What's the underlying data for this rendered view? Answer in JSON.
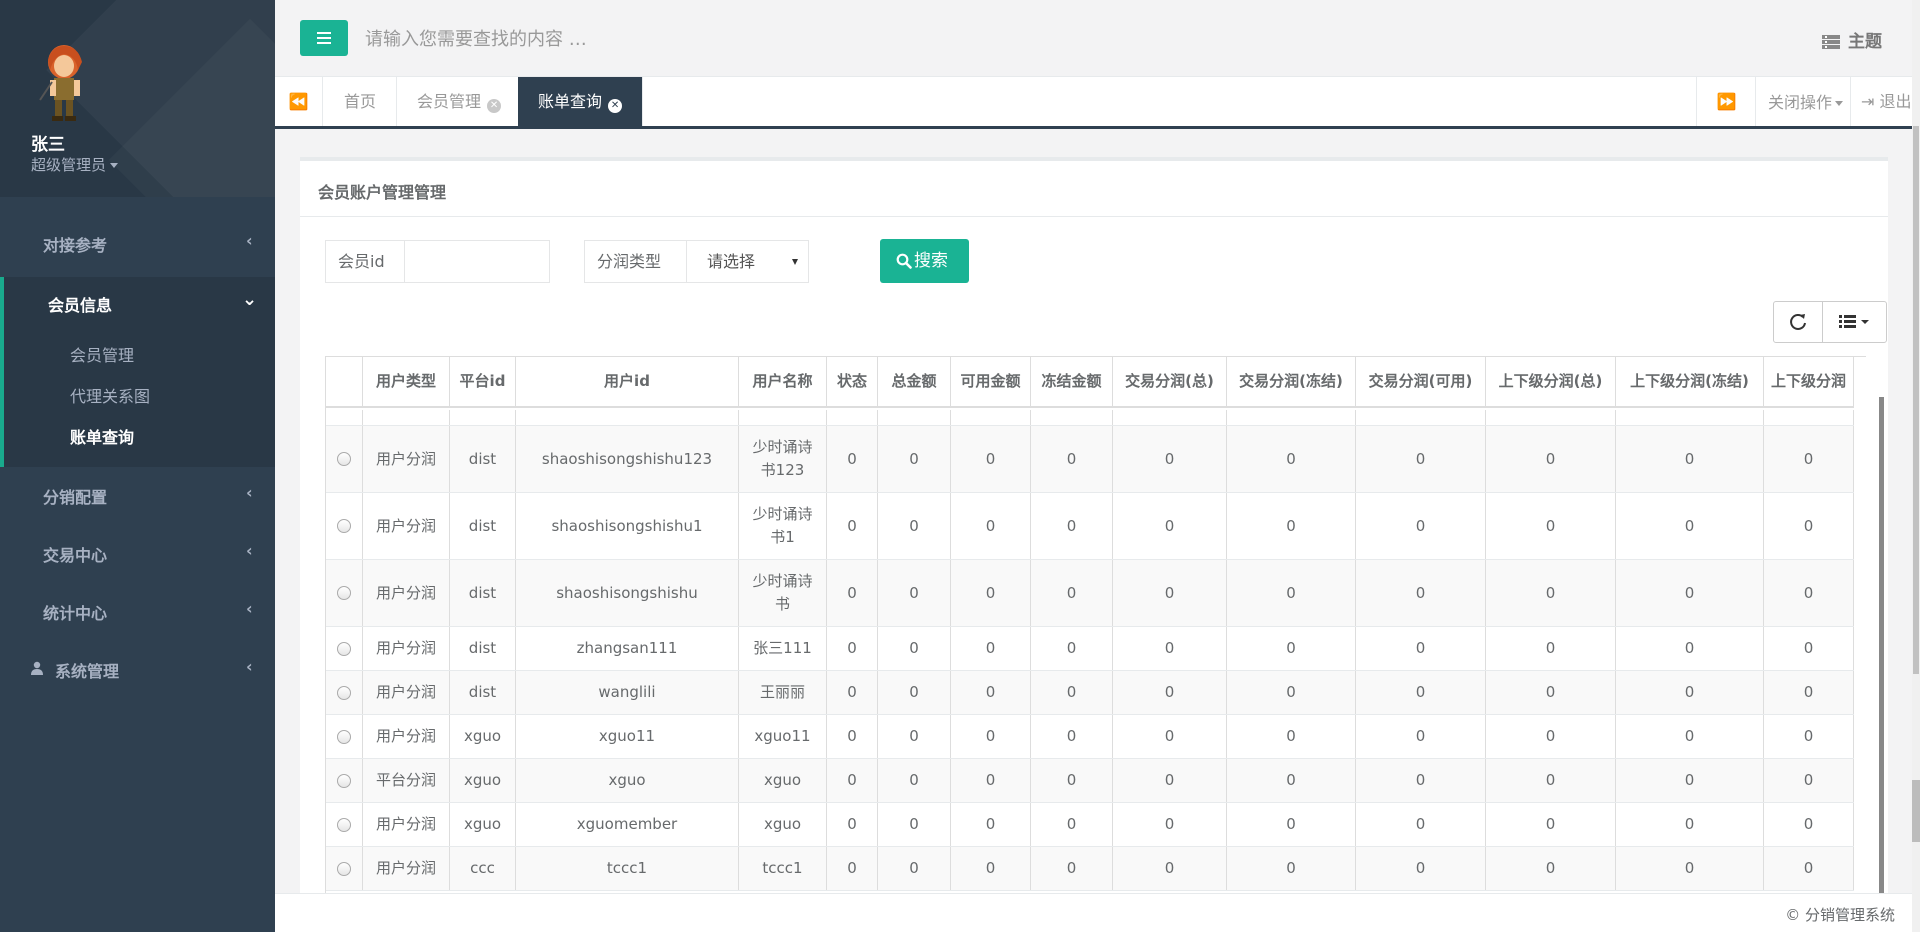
{
  "sidebar": {
    "profile": {
      "name": "张三",
      "role": "超级管理员"
    },
    "menu": [
      {
        "label": "对接参考"
      },
      {
        "label": "会员信息",
        "children": [
          "会员管理",
          "代理关系图",
          "账单查询"
        ]
      },
      {
        "label": "分销配置"
      },
      {
        "label": "交易中心"
      },
      {
        "label": "统计中心"
      },
      {
        "label": "系统管理",
        "icon": "user-icon"
      }
    ]
  },
  "topbar": {
    "search_placeholder": "请输入您需要查找的内容 …",
    "theme_label": "主题"
  },
  "tabs": {
    "items": [
      {
        "label": "首页",
        "closable": false
      },
      {
        "label": "会员管理",
        "closable": true
      },
      {
        "label": "账单查询",
        "closable": true,
        "active": true
      }
    ],
    "close_ops_label": "关闭操作",
    "logout_label": "退出"
  },
  "panel": {
    "title": "会员账户管理管理",
    "filters": {
      "member_id_label": "会员id",
      "member_id_value": "",
      "type_label": "分润类型",
      "type_value": "请选择"
    },
    "search_button": "搜索"
  },
  "table": {
    "columns": [
      "",
      "用户类型",
      "平台id",
      "用户id",
      "用户名称",
      "状态",
      "总金额",
      "可用金额",
      "冻结金额",
      "交易分润(总)",
      "交易分润(冻结)",
      "交易分润(可用)",
      "上下级分润(总)",
      "上下级分润(冻结)",
      "上下级分润"
    ],
    "partial_top_text": "...",
    "rows": [
      [
        "用户分润",
        "dist",
        "shaoshisongshishu123",
        "少时诵诗书123",
        "0",
        "0",
        "0",
        "0",
        "0",
        "0",
        "0",
        "0",
        "0",
        "0"
      ],
      [
        "用户分润",
        "dist",
        "shaoshisongshishu1",
        "少时诵诗书1",
        "0",
        "0",
        "0",
        "0",
        "0",
        "0",
        "0",
        "0",
        "0",
        "0"
      ],
      [
        "用户分润",
        "dist",
        "shaoshisongshishu",
        "少时诵诗书",
        "0",
        "0",
        "0",
        "0",
        "0",
        "0",
        "0",
        "0",
        "0",
        "0"
      ],
      [
        "用户分润",
        "dist",
        "zhangsan111",
        "张三111",
        "0",
        "0",
        "0",
        "0",
        "0",
        "0",
        "0",
        "0",
        "0",
        "0"
      ],
      [
        "用户分润",
        "dist",
        "wanglili",
        "王丽丽",
        "0",
        "0",
        "0",
        "0",
        "0",
        "0",
        "0",
        "0",
        "0",
        "0"
      ],
      [
        "用户分润",
        "xguo",
        "xguo11",
        "xguo11",
        "0",
        "0",
        "0",
        "0",
        "0",
        "0",
        "0",
        "0",
        "0",
        "0"
      ],
      [
        "平台分润",
        "xguo",
        "xguo",
        "xguo",
        "0",
        "0",
        "0",
        "0",
        "0",
        "0",
        "0",
        "0",
        "0",
        "0"
      ],
      [
        "用户分润",
        "xguo",
        "xguomember",
        "xguo",
        "0",
        "0",
        "0",
        "0",
        "0",
        "0",
        "0",
        "0",
        "0",
        "0"
      ],
      [
        "用户分润",
        "ccc",
        "tccc1",
        "tccc1",
        "0",
        "0",
        "0",
        "0",
        "0",
        "0",
        "0",
        "0",
        "0",
        "0"
      ]
    ]
  },
  "footer": {
    "copyright": "© 分销管理系统"
  },
  "colors": {
    "sidebar": "#2f4050",
    "accent": "#1ab394",
    "text": "#676a6c"
  }
}
